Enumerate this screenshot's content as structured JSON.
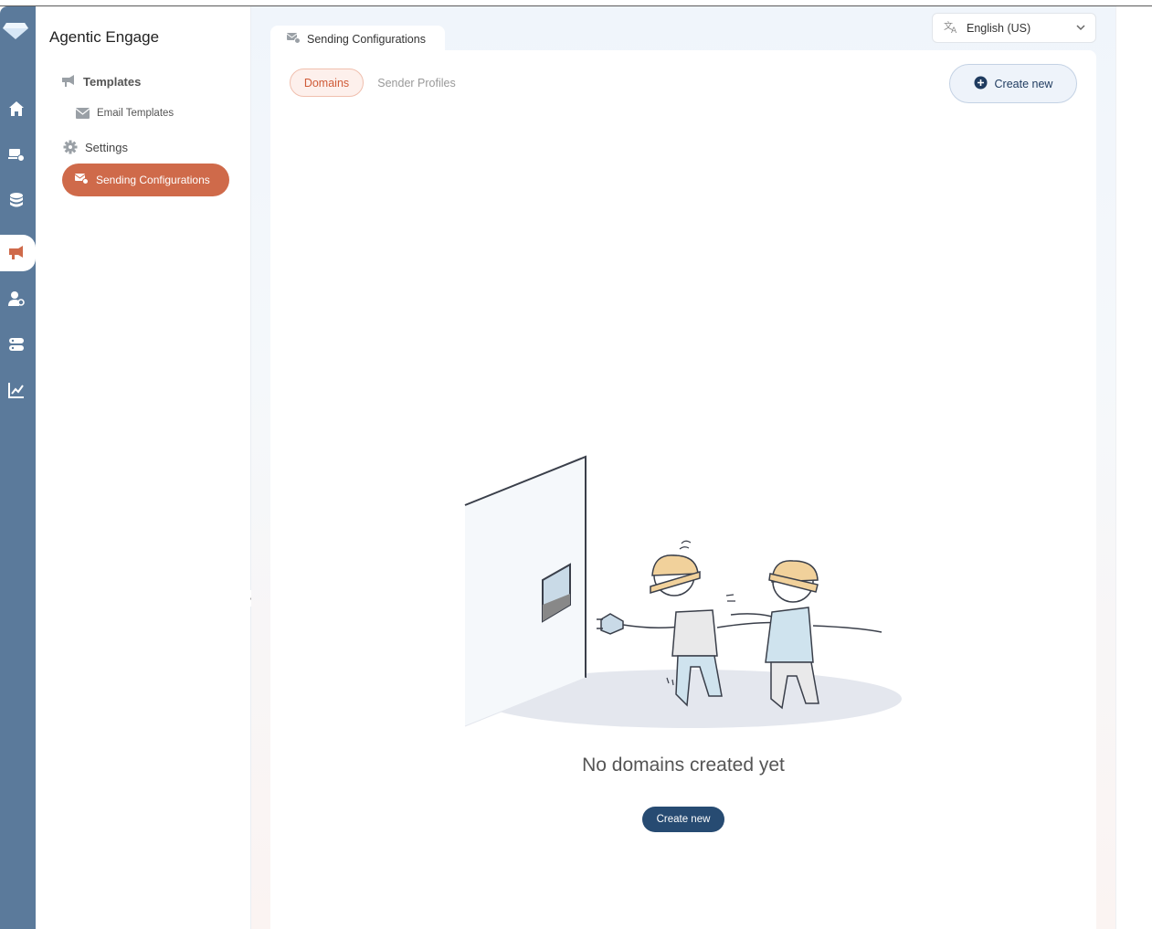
{
  "rail": {
    "icons": [
      "diamond-logo-icon",
      "home-icon",
      "user-settings-icon",
      "database-icon",
      "megaphone-icon",
      "person-search-icon",
      "server-icon",
      "analytics-icon"
    ],
    "active_index": 4,
    "color": "#5b7a9b"
  },
  "sidebar": {
    "app_title": "Agentic Engage",
    "items": [
      {
        "label": "Templates",
        "icon": "megaphone-icon"
      },
      {
        "label": "Email Templates",
        "icon": "mail-icon"
      },
      {
        "label": "Settings",
        "icon": "gear-icon"
      },
      {
        "label": "Sending Configurations",
        "icon": "mail-gear-icon",
        "active": true
      }
    ],
    "active_color": "#cf6a4a"
  },
  "header": {
    "tab_label": "Sending Configurations",
    "language": "English (US)"
  },
  "main": {
    "tabs": [
      {
        "label": "Domains",
        "active": true
      },
      {
        "label": "Sender Profiles",
        "active": false
      }
    ],
    "create_button": "Create new",
    "empty_message": "No domains created yet",
    "empty_create_button": "Create new",
    "accent_button_color": "#274b72"
  }
}
